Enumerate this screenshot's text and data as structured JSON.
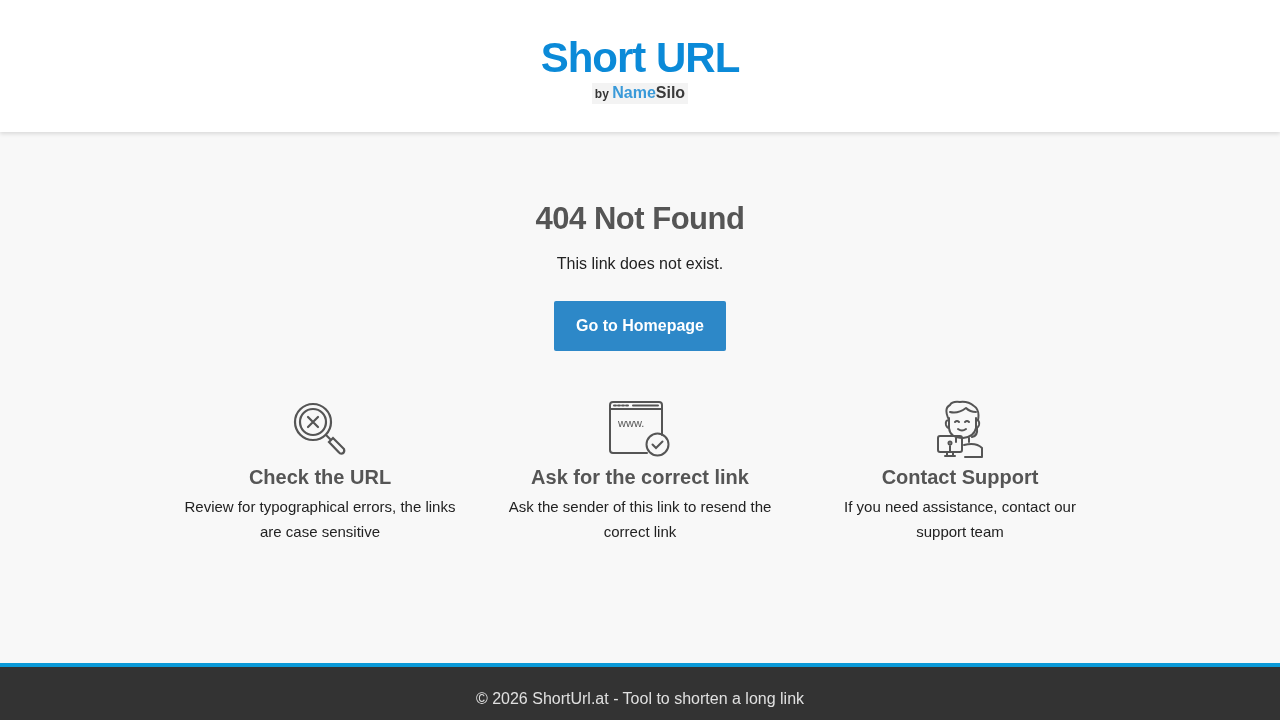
{
  "logo": {
    "title": "Short URL",
    "byline": {
      "prefix": "by",
      "brand": [
        "Name",
        "Silo"
      ]
    }
  },
  "error": {
    "heading": "404 Not Found",
    "message": "This link does not exist.",
    "button": "Go to Homepage"
  },
  "features": [
    {
      "kind": "magnifier",
      "title": "Check the URL",
      "text": "Review for typographical errors, the links are case sensitive"
    },
    {
      "kind": "browser",
      "icon_text": "www.",
      "title": "Ask for the correct link",
      "text": "Ask the sender of this link to resend the correct link"
    },
    {
      "kind": "support",
      "title": "Contact Support",
      "text": "If you need assistance, contact our support team"
    }
  ],
  "footer": {
    "text": "© 2026 ShortUrl.at - Tool to shorten a long link"
  }
}
